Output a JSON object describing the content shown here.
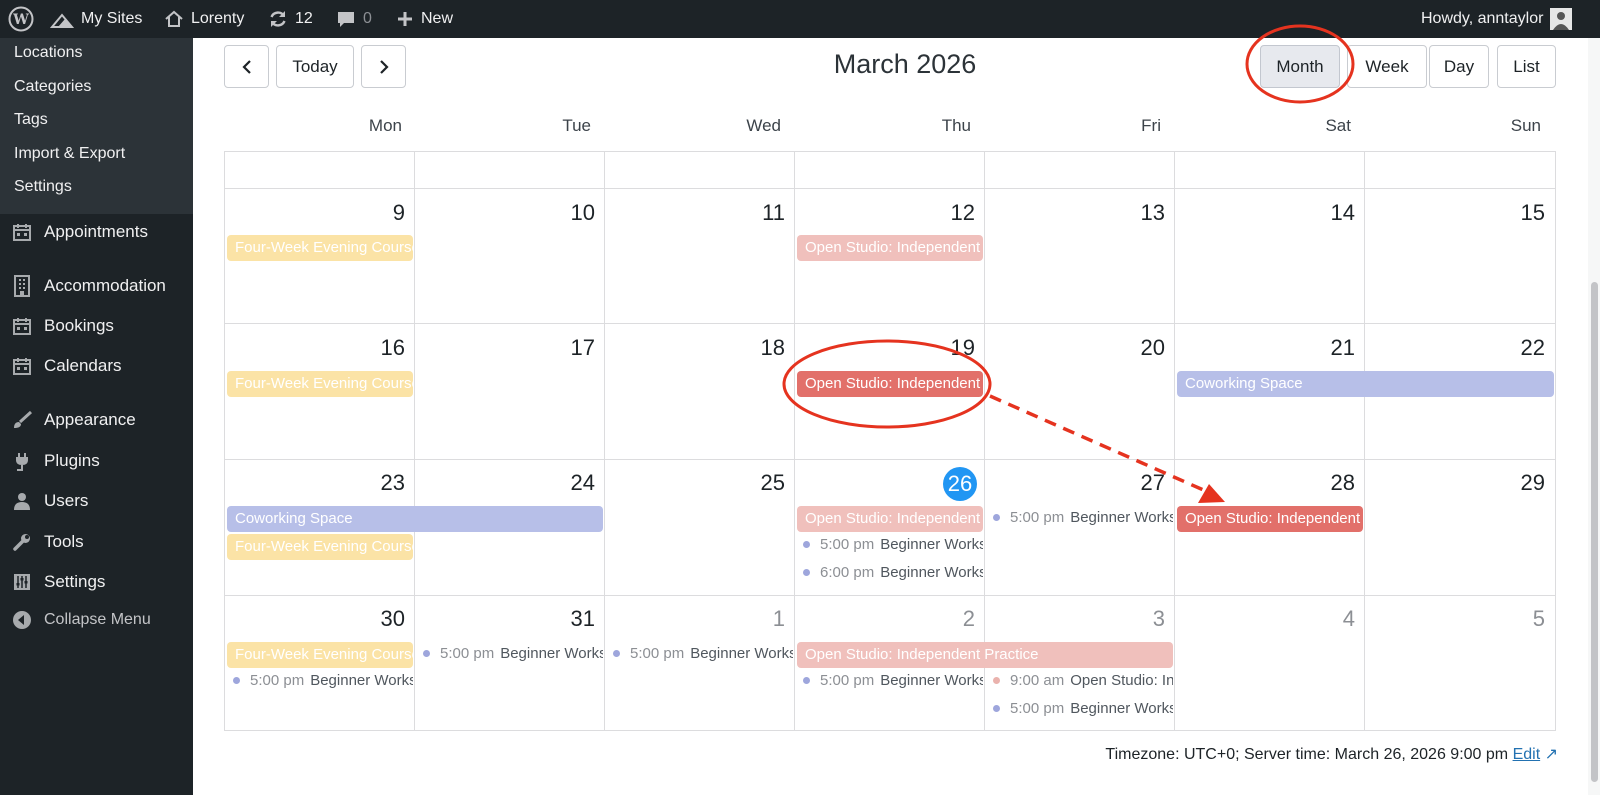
{
  "adminbar": {
    "my_sites": "My Sites",
    "site_name": "Lorenty",
    "updates_count": "12",
    "comments_count": "0",
    "new_label": "New",
    "greeting": "Howdy, anntaylor"
  },
  "sidebar": {
    "submenu": [
      "Locations",
      "Categories",
      "Tags",
      "Import & Export",
      "Settings"
    ],
    "menu": [
      {
        "label": "Appointments",
        "icon": "calendar-icon"
      },
      {
        "label": "Accommodation",
        "icon": "building-icon"
      },
      {
        "label": "Bookings",
        "icon": "calendar-icon"
      },
      {
        "label": "Calendars",
        "icon": "calendar-icon"
      },
      {
        "label": "Appearance",
        "icon": "brush-icon"
      },
      {
        "label": "Plugins",
        "icon": "plug-icon"
      },
      {
        "label": "Users",
        "icon": "user-icon"
      },
      {
        "label": "Tools",
        "icon": "wrench-icon"
      },
      {
        "label": "Settings",
        "icon": "sliders-icon"
      }
    ],
    "collapse": "Collapse Menu"
  },
  "toolbar": {
    "prev_icon": "chevron-left-icon",
    "next_icon": "chevron-right-icon",
    "today": "Today",
    "title": "March 2026",
    "views": [
      "Month",
      "Week",
      "Day",
      "List"
    ],
    "active_view": "Month"
  },
  "calendar": {
    "weekdays": [
      "Mon",
      "Tue",
      "Wed",
      "Thu",
      "Fri",
      "Sat",
      "Sun"
    ],
    "weeks": [
      [
        "9",
        "10",
        "11",
        "12",
        "13",
        "14",
        "15"
      ],
      [
        "16",
        "17",
        "18",
        "19",
        "20",
        "21",
        "22"
      ],
      [
        "23",
        "24",
        "25",
        "26",
        "27",
        "28",
        "29"
      ],
      [
        "30",
        "31",
        "1",
        "2",
        "3",
        "4",
        "5"
      ]
    ],
    "today": "26",
    "events": {
      "four_week": "Four-Week Evening Course",
      "open_studio": "Open Studio: Independent Practice",
      "coworking": "Coworking Space",
      "beginner": "Beginner Workshop"
    },
    "times": {
      "t500": "5:00 pm",
      "t600": "6:00 pm",
      "t900": "9:00 am"
    }
  },
  "footer": {
    "timezone": "Timezone: UTC+0; Server time: March 26, 2026 9:00 pm",
    "edit": "Edit"
  },
  "colors": {
    "yellow": "#fbe3a6",
    "pink": "#f0c0bc",
    "red": "#e2706a",
    "blue": "#b7bfe8",
    "today": "#2196f3",
    "annotation": "#e5331f"
  }
}
